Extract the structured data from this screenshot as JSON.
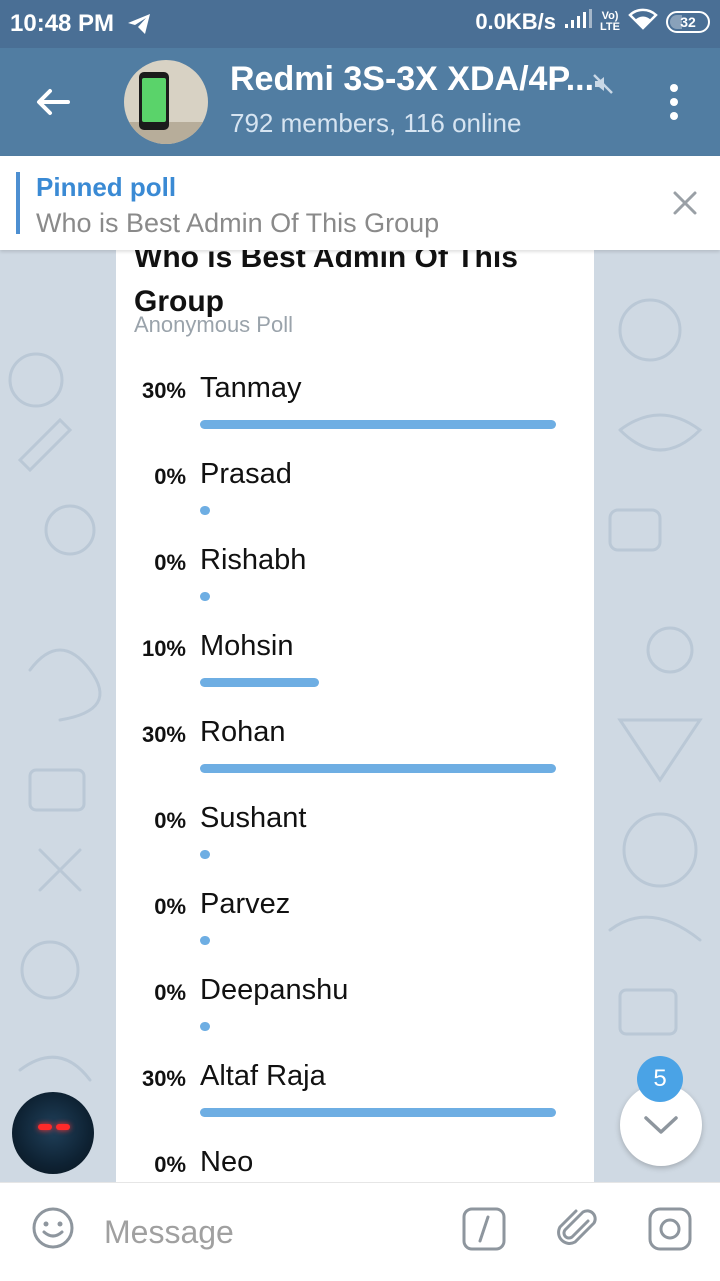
{
  "status_bar": {
    "time": "10:48 PM",
    "network_speed": "0.0KB/s",
    "lte_top": "Vo)",
    "lte_bottom": "LTE",
    "battery": "32"
  },
  "header": {
    "title": "Redmi 3S-3X XDA/4P...",
    "subtitle": "792 members, 116 online"
  },
  "pinned": {
    "label": "Pinned poll",
    "text": "Who is Best Admin Of This Group"
  },
  "poll": {
    "question": "Who is Best Admin Of This Group",
    "type": "Anonymous Poll",
    "options": [
      {
        "percent": "30%",
        "name": "Tanmay",
        "value": 30
      },
      {
        "percent": "0%",
        "name": "Prasad",
        "value": 0
      },
      {
        "percent": "0%",
        "name": "Rishabh",
        "value": 0
      },
      {
        "percent": "10%",
        "name": "Mohsin",
        "value": 10
      },
      {
        "percent": "30%",
        "name": "Rohan",
        "value": 30
      },
      {
        "percent": "0%",
        "name": "Sushant",
        "value": 0
      },
      {
        "percent": "0%",
        "name": "Parvez",
        "value": 0
      },
      {
        "percent": "0%",
        "name": "Deepanshu",
        "value": 0
      },
      {
        "percent": "30%",
        "name": "Altaf Raja",
        "value": 30
      },
      {
        "percent": "0%",
        "name": "Neo",
        "value": 0
      }
    ]
  },
  "scroll": {
    "unread_count": "5"
  },
  "composer": {
    "placeholder": "Message"
  },
  "colors": {
    "header": "#517da2",
    "status_bar": "#4a6f95",
    "accent": "#6eaee3",
    "pinned_accent": "#3a8ad4",
    "badge": "#4aa3e6"
  },
  "icons": {
    "telegram": "telegram-icon",
    "signal": "signal-icon",
    "wifi": "wifi-icon",
    "battery": "battery-icon",
    "back": "back-arrow-icon",
    "mute": "mute-icon",
    "menu": "more-vert-icon",
    "close": "close-icon",
    "emoji": "emoji-icon",
    "command": "bot-command-icon",
    "attach": "attach-icon",
    "camera": "camera-icon",
    "scroll_down": "chevron-down-icon"
  }
}
